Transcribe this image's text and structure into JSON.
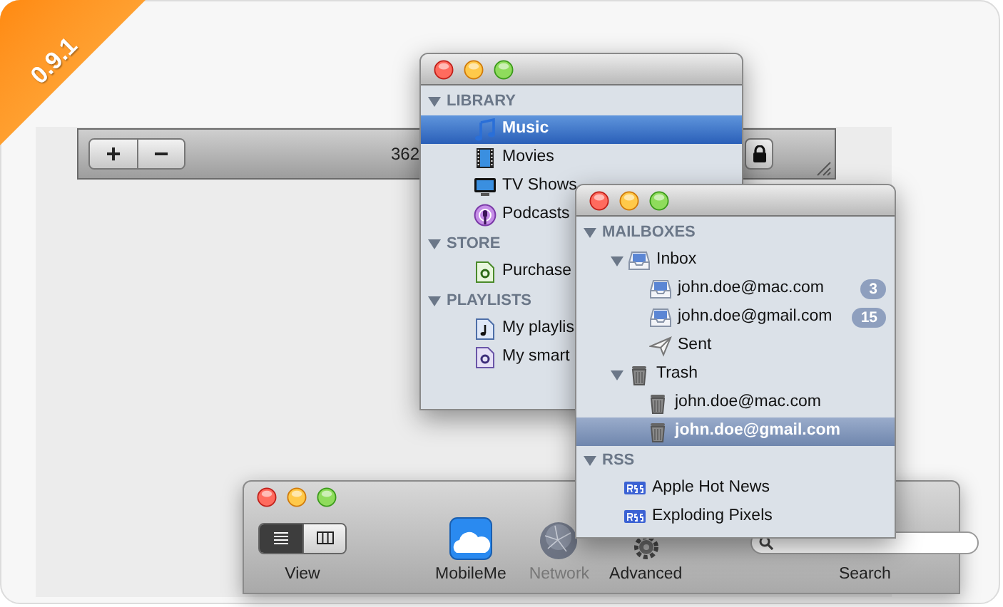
{
  "version_badge": "0.9.1",
  "list_bar": {
    "buttons": [
      "+",
      "−"
    ],
    "count": "362"
  },
  "library_window": {
    "sections": [
      {
        "title": "LIBRARY",
        "expanded": true,
        "items": [
          {
            "label": "Music",
            "kind": "music",
            "selected": true
          },
          {
            "label": "Movies",
            "kind": "movies",
            "selected": false
          },
          {
            "label": "TV Shows",
            "kind": "tv",
            "selected": false
          },
          {
            "label": "Podcasts",
            "kind": "podcast",
            "selected": false
          }
        ]
      },
      {
        "title": "STORE",
        "expanded": true,
        "items": [
          {
            "label": "Purchase",
            "kind": "purchased",
            "selected": false
          }
        ]
      },
      {
        "title": "PLAYLISTS",
        "expanded": true,
        "items": [
          {
            "label": "My playlis",
            "kind": "playlist",
            "selected": false
          },
          {
            "label": "My smart",
            "kind": "smart",
            "selected": false
          }
        ]
      }
    ]
  },
  "mail_window": {
    "sections": [
      {
        "title": "MAILBOXES",
        "expanded": true,
        "items": [
          {
            "label": "Inbox",
            "kind": "inbox",
            "selected": false,
            "expanded": true,
            "children": [
              {
                "label": "john.doe@mac.com",
                "kind": "inbox",
                "selected": false,
                "badge": "3"
              },
              {
                "label": "john.doe@gmail.com",
                "kind": "inbox",
                "selected": false,
                "badge": "15"
              },
              {
                "label": "Sent",
                "kind": "sent",
                "selected": false
              }
            ]
          },
          {
            "label": "Trash",
            "kind": "trash",
            "selected": false,
            "expanded": true,
            "children": [
              {
                "label": "john.doe@mac.com",
                "kind": "trash",
                "selected": false
              },
              {
                "label": "john.doe@gmail.com",
                "kind": "trash",
                "selected": true
              }
            ]
          }
        ]
      },
      {
        "title": "RSS",
        "expanded": true,
        "items": [
          {
            "label": "Apple Hot News",
            "kind": "rss",
            "selected": false
          },
          {
            "label": "Exploding Pixels",
            "kind": "rss",
            "selected": false
          }
        ]
      }
    ]
  },
  "prefs_window": {
    "view_modes": [
      {
        "kind": "list",
        "selected": true
      },
      {
        "kind": "columns",
        "selected": false
      }
    ],
    "view_label": "View",
    "tools": [
      {
        "label": "MobileMe",
        "kind": "mobileme",
        "disabled": false
      },
      {
        "label": "Network",
        "kind": "network",
        "disabled": true
      },
      {
        "label": "Advanced",
        "kind": "advanced",
        "disabled": false
      }
    ],
    "search_label": "Search"
  }
}
